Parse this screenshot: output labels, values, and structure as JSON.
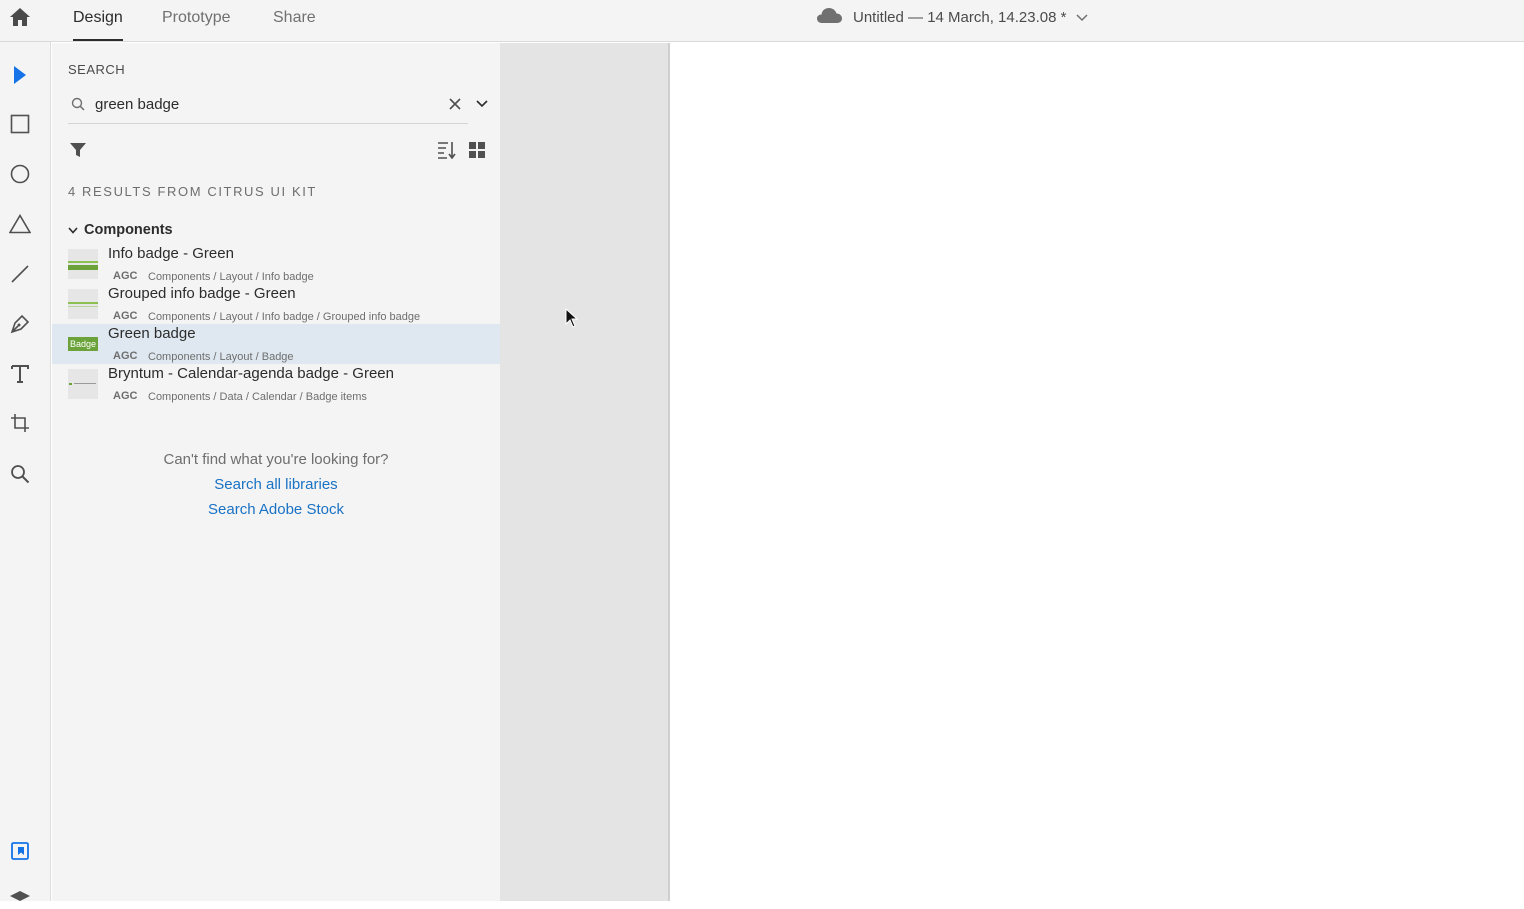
{
  "app": {
    "tabs": [
      {
        "label": "Design",
        "active": true
      },
      {
        "label": "Prototype",
        "active": false
      },
      {
        "label": "Share",
        "active": false
      }
    ],
    "document_title": "Untitled — 14 March, 14.23.08 *"
  },
  "tools": [
    "select-tool",
    "rectangle-tool",
    "ellipse-tool",
    "polygon-tool",
    "line-tool",
    "pen-tool",
    "text-tool",
    "artboard-tool",
    "zoom-tool",
    "libraries-panel",
    "layers-panel"
  ],
  "search": {
    "heading": "SEARCH",
    "query": "green badge",
    "results_summary": "4 RESULTS FROM CITRUS UI KIT"
  },
  "groups": [
    {
      "label": "Components",
      "items": [
        {
          "name": "Info badge - Green",
          "type": "AGC",
          "path": "Components / Layout / Info badge",
          "selected": false
        },
        {
          "name": "Grouped info badge - Green",
          "type": "AGC",
          "path": "Components / Layout / Info badge / Grouped info badge",
          "selected": false
        },
        {
          "name": "Green badge",
          "type": "AGC",
          "path": "Components / Layout / Badge",
          "selected": true,
          "thumb_text": "Badge"
        },
        {
          "name": "Bryntum - Calendar-agenda badge - Green",
          "type": "AGC",
          "path": "Components / Data / Calendar / Badge items",
          "selected": false
        }
      ]
    }
  ],
  "empty_state": {
    "question": "Can't find what you're looking for?",
    "link_all_libraries": "Search all libraries",
    "link_adobe_stock": "Search Adobe Stock"
  },
  "colors": {
    "accent": "#1473e6",
    "link": "#1a72c4",
    "badge_green": "#6ba33a",
    "selected_row": "#dfe8f0"
  }
}
